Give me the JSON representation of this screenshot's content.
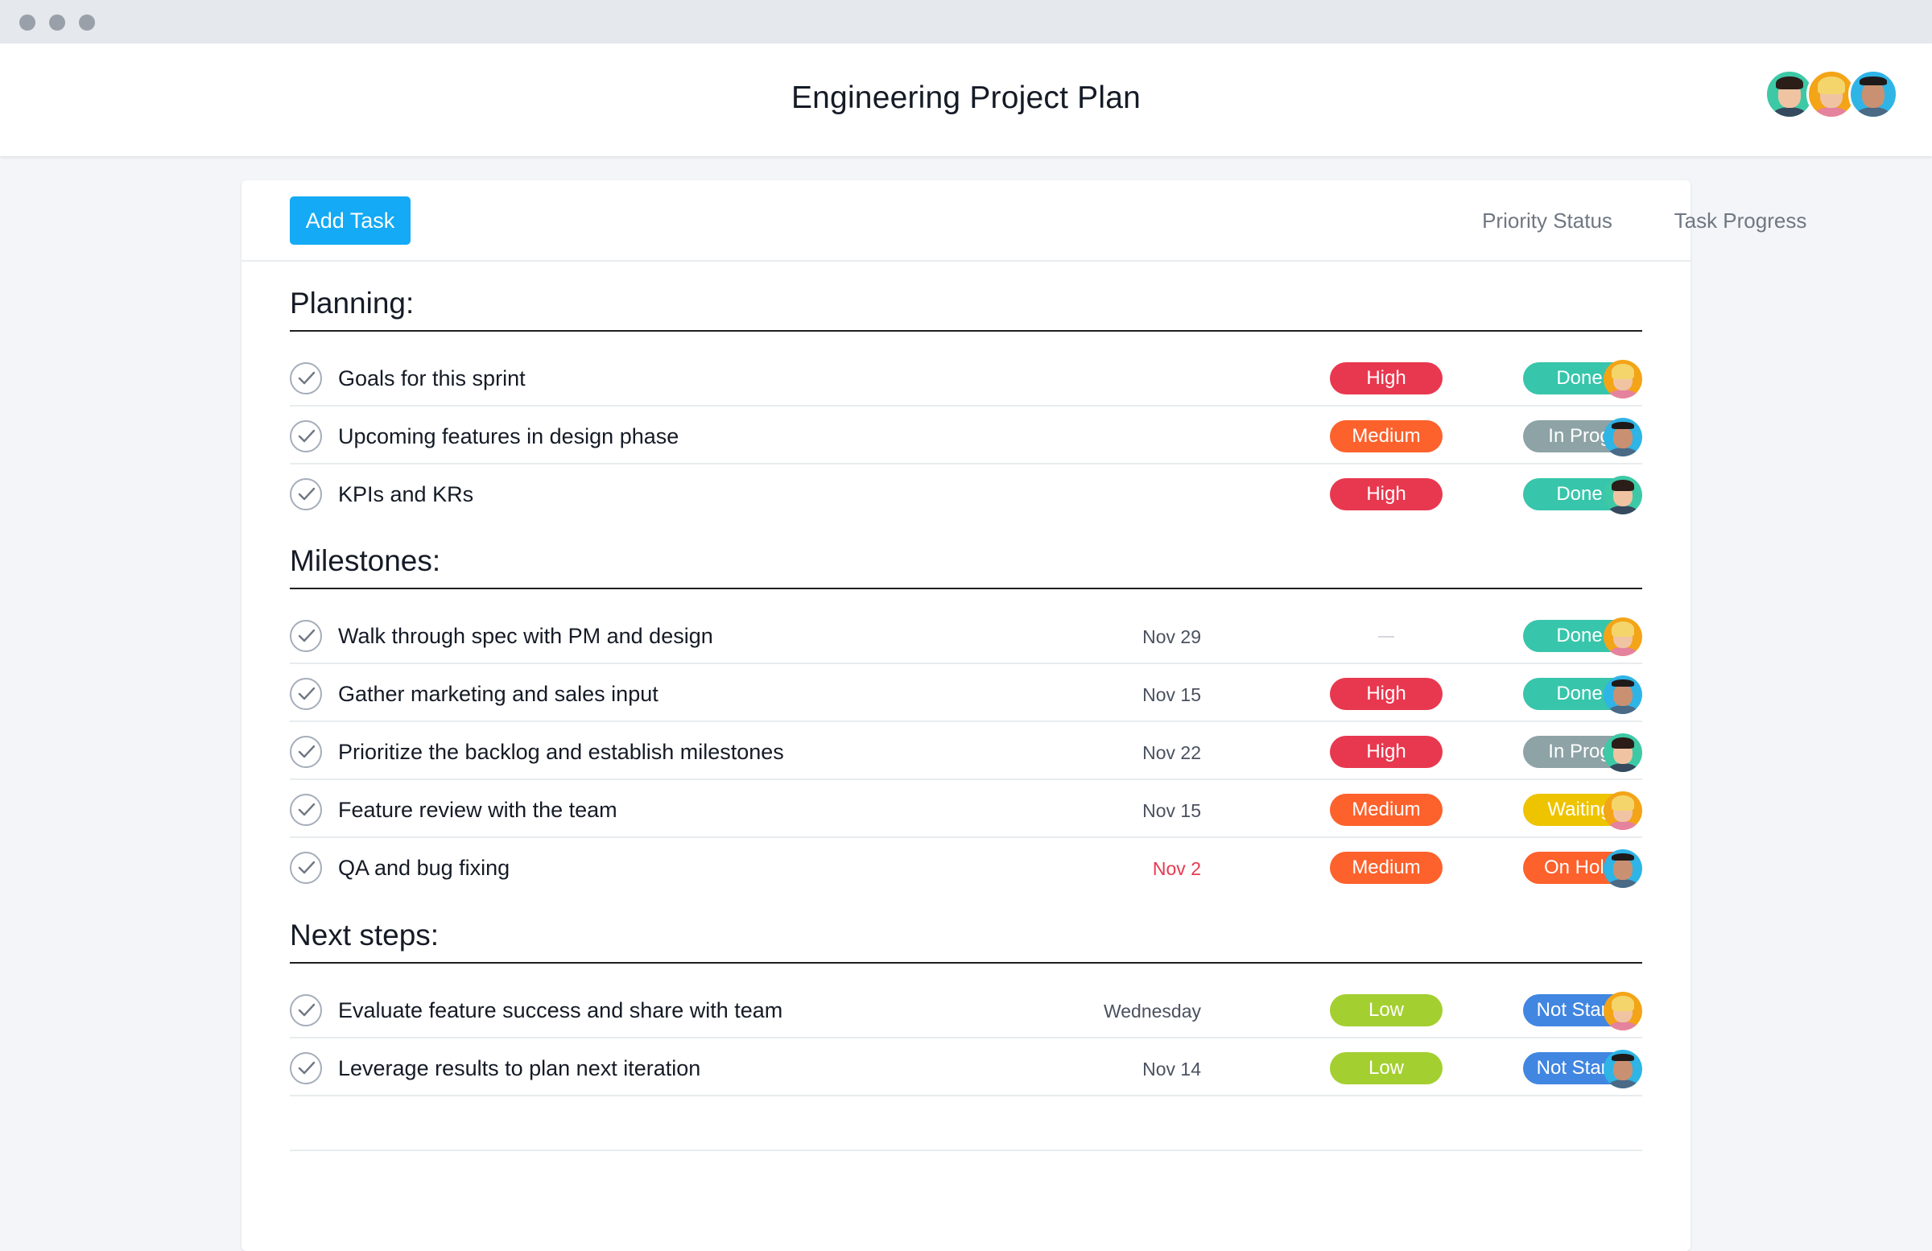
{
  "header": {
    "title": "Engineering Project Plan",
    "avatars": [
      "teal",
      "orange",
      "blue"
    ]
  },
  "toolbar": {
    "add_task": "Add Task",
    "priority_header": "Priority Status",
    "progress_header": "Task Progress"
  },
  "colors": {
    "High": "#e8384f",
    "Medium": "#fd612c",
    "Low": "#a4cf30",
    "Done": "#37c5ab",
    "In Prog": "#8da3a6",
    "Waiting": "#eec300",
    "On Hold": "#fd612c",
    "Not Star...": "#4186e0",
    "accent": "#14aaf5"
  },
  "sections": [
    {
      "title": "Planning:"
    },
    {
      "title": "Milestones:"
    },
    {
      "title": "Next steps:"
    }
  ],
  "tasks": [
    {
      "name": "Goals for this sprint",
      "date": "",
      "priority": "High",
      "progress": "Done",
      "assignee": "orange",
      "overdue": false
    },
    {
      "name": "Upcoming features in design phase",
      "date": "",
      "priority": "Medium",
      "progress": "In Prog",
      "assignee": "blue",
      "overdue": false
    },
    {
      "name": "KPIs and KRs",
      "date": "",
      "priority": "High",
      "progress": "Done",
      "assignee": "teal",
      "overdue": false
    },
    {
      "name": "Walk through spec with PM and design",
      "date": "Nov 29",
      "priority": "",
      "progress": "Done",
      "assignee": "orange",
      "overdue": false
    },
    {
      "name": "Gather marketing and sales input",
      "date": "Nov 15",
      "priority": "High",
      "progress": "Done",
      "assignee": "blue",
      "overdue": false
    },
    {
      "name": "Prioritize the backlog and establish milestones",
      "date": "Nov 22",
      "priority": "High",
      "progress": "In Prog",
      "assignee": "teal",
      "overdue": false
    },
    {
      "name": "Feature review with the team",
      "date": "Nov 15",
      "priority": "Medium",
      "progress": "Waiting",
      "assignee": "orange",
      "overdue": false
    },
    {
      "name": "QA and bug fixing",
      "date": "Nov 2",
      "priority": "Medium",
      "progress": "On Hold",
      "assignee": "blue",
      "overdue": true
    },
    {
      "name": "Evaluate feature success and share with team",
      "date": "Wednesday",
      "priority": "Low",
      "progress": "Not Star...",
      "assignee": "orange",
      "overdue": false
    },
    {
      "name": "Leverage results to plan next iteration",
      "date": "Nov 14",
      "priority": "Low",
      "progress": "Not Star...",
      "assignee": "blue",
      "overdue": false
    }
  ]
}
